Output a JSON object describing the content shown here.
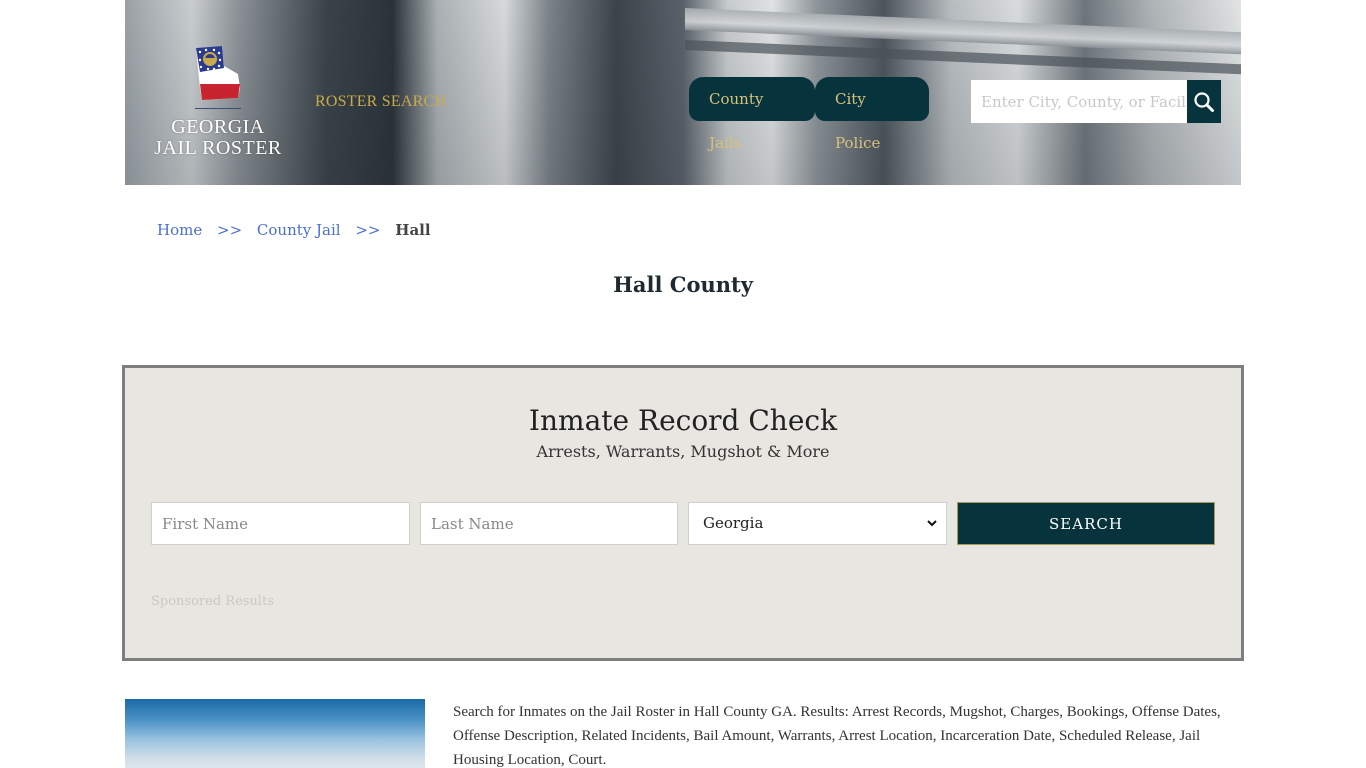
{
  "header": {
    "logo_line1": "GEORGIA",
    "logo_line2": "JAIL ROSTER",
    "roster_search_label": "ROSTER SEARCH",
    "nav": [
      {
        "label": "County Jails"
      },
      {
        "label": "City Police"
      }
    ],
    "search": {
      "placeholder": "Enter City, County, or Facility",
      "value": "",
      "button_icon": "search-icon"
    }
  },
  "breadcrumb": {
    "items": [
      {
        "label": "Home"
      },
      {
        "label": "County Jail"
      }
    ],
    "separator": ">>",
    "current": "Hall"
  },
  "page": {
    "title": "Hall County"
  },
  "record_check": {
    "title": "Inmate Record Check",
    "subtitle": "Arrests, Warrants, Mugshot & More",
    "first_name_placeholder": "First Name",
    "last_name_placeholder": "Last Name",
    "state_selected": "Georgia",
    "submit_label": "SEARCH",
    "sponsored_label": "Sponsored Results"
  },
  "description": {
    "text": "Search for Inmates on the Jail Roster in Hall County GA. Results: Arrest Records, Mugshot, Charges, Bookings, Offense Dates, Offense Description, Related Incidents, Bail Amount, Warrants, Arrest Location, Incarceration Date, Scheduled Release, Jail Housing Location, Court."
  },
  "colors": {
    "primary_dark": "#06333c",
    "accent_gold": "#c9a94a",
    "link_blue": "#4a6fd1",
    "panel_bg": "#e8e6e1"
  }
}
